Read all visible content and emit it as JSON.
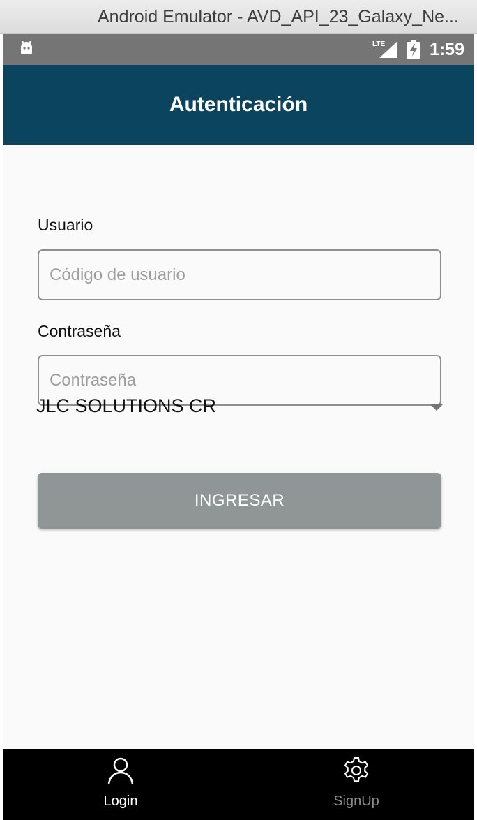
{
  "window": {
    "title": "Android Emulator - AVD_API_23_Galaxy_Ne..."
  },
  "statusbar": {
    "network_label": "LTE",
    "time": "1:59"
  },
  "appbar": {
    "title": "Autenticación",
    "color": "#0b445e"
  },
  "form": {
    "username_label": "Usuario",
    "username_placeholder": "Código de usuario",
    "username_value": "",
    "password_label": "Contraseña",
    "password_placeholder": "Contraseña",
    "password_value": "",
    "company_selected": "JLC SOLUTIONS CR",
    "submit_label": "INGRESAR"
  },
  "bottom_nav": {
    "tabs": [
      {
        "label": "Login",
        "icon": "person-icon",
        "active": true
      },
      {
        "label": "SignUp",
        "icon": "gear-icon",
        "active": false
      }
    ]
  }
}
